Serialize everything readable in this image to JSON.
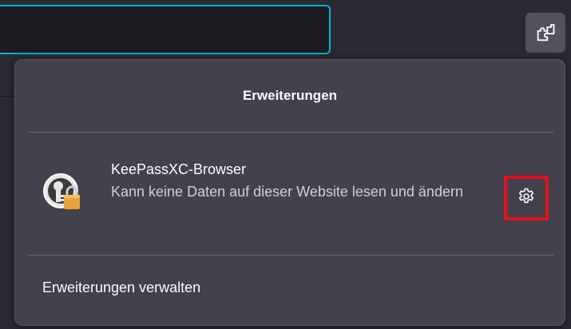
{
  "toolbar": {
    "url_value": "",
    "extensions_button_icon": "puzzle-piece-icon"
  },
  "panel": {
    "title": "Erweiterungen",
    "extension": {
      "icon": "keepassxc-lock-icon",
      "name": "KeePassXC-Browser",
      "description": "Kann keine Daten auf dieser Website lesen und ändern",
      "settings_icon": "gear-icon"
    },
    "manage_label": "Erweiterungen verwalten"
  },
  "colors": {
    "toolbar_bg": "#2b2a33",
    "panel_bg": "#42414d",
    "focus_ring": "#00b3d4",
    "highlight_box": "#e8101b",
    "keepass_lock": "#e8a23a"
  }
}
